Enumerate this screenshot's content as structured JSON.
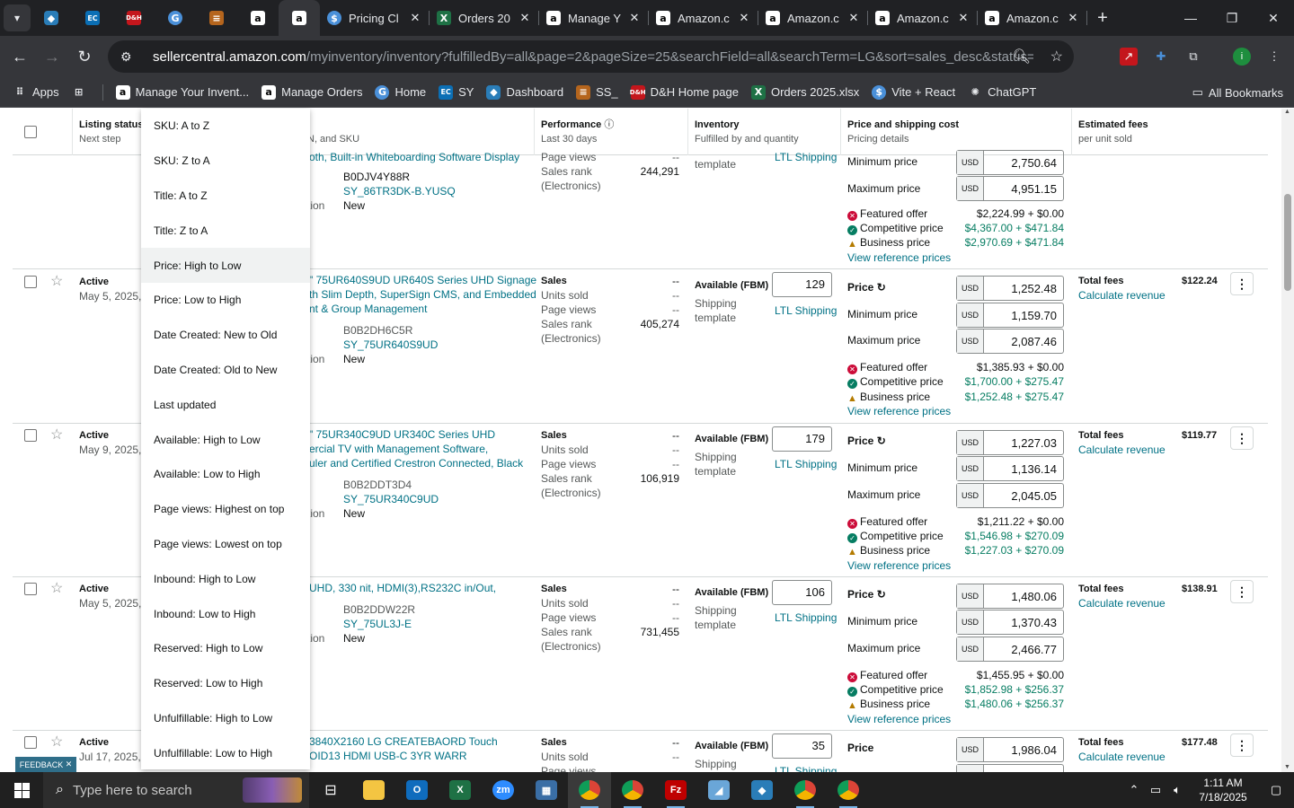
{
  "browser": {
    "tabs": [
      {
        "title": "Pricing Cl",
        "icon": "pricing-icon"
      },
      {
        "title": "Orders 20",
        "icon": "excel-icon"
      },
      {
        "title": "Manage Y",
        "icon": "amazon-icon"
      },
      {
        "title": "Amazon.c",
        "icon": "amazon-icon"
      },
      {
        "title": "Amazon.c",
        "icon": "amazon-icon"
      },
      {
        "title": "Amazon.c",
        "icon": "amazon-icon"
      },
      {
        "title": "Amazon.c",
        "icon": "amazon-icon"
      }
    ],
    "url_host": "sellercentral.amazon.com",
    "url_path": "/myinventory/inventory?fulfilledBy=all&page=2&pageSize=25&searchField=all&searchTerm=LG&sort=sales_desc&status=active&ref...",
    "profile_initial": "i",
    "bookmarks": [
      {
        "label": "Apps",
        "icon": "apps-grid-icon"
      },
      {
        "label": "Manage Your Invent...",
        "icon": "amazon-icon"
      },
      {
        "label": "Manage Orders",
        "icon": "amazon-icon"
      },
      {
        "label": "Home",
        "icon": "google-drive-icon"
      },
      {
        "label": "SY",
        "icon": "ec-icon"
      },
      {
        "label": "Dashboard",
        "icon": "dashboard-icon"
      },
      {
        "label": "SS_",
        "icon": "ss-icon"
      },
      {
        "label": "D&H Home page",
        "icon": "dh-icon"
      },
      {
        "label": "Orders 2025.xlsx",
        "icon": "excel-icon"
      },
      {
        "label": "Vite + React",
        "icon": "vite-icon"
      },
      {
        "label": "ChatGPT",
        "icon": "chatgpt-icon"
      }
    ],
    "all_bookmarks": "All Bookmarks"
  },
  "table_header": {
    "listing_status": "Listing status",
    "next_step": "Next step",
    "product_suffix": "N, and SKU",
    "performance": "Performance",
    "last_30_days": "Last 30 days",
    "inventory": "Inventory",
    "fulfilled_by": "Fulfilled by and quantity",
    "price_shipping": "Price and shipping cost",
    "pricing_details": "Pricing details",
    "estimated_fees": "Estimated fees",
    "per_unit": "per unit sold"
  },
  "labels": {
    "sales": "Sales",
    "units_sold": "Units sold",
    "page_views": "Page views",
    "sales_rank": "Sales rank",
    "electronics": "(Electronics)",
    "available_fbm": "Available (FBM)",
    "shipping": "Shipping",
    "template": "template",
    "ltl": "LTL Shipping",
    "price": "Price",
    "min_price": "Minimum price",
    "max_price": "Maximum price",
    "usd": "USD",
    "featured": "Featured offer",
    "competitive": "Competitive price",
    "business": "Business price",
    "view_ref": "View reference prices",
    "total_fees": "Total fees",
    "calc_revenue": "Calculate revenue",
    "condition_suffix": "tion",
    "condition": "New",
    "dash": "--",
    "active": "Active"
  },
  "partial_row": {
    "title": "oth, Built-in Whiteboarding Software Display",
    "asin": "B0DJV4Y88R",
    "sku": "SY_86TR3DK-B.YUSQ",
    "page_views_label": "Page views",
    "dash": "--",
    "sales_rank": "244,291",
    "min_price": "2,750.64",
    "max_price": "4,951.15",
    "featured": "$2,224.99 + $0.00",
    "competitive": "$4,367.00 + $471.84",
    "business": "$2,970.69 + $471.84",
    "ship_partial": "LTL Shipping"
  },
  "rows": [
    {
      "date": "May 5, 2025,",
      "title": [
        "\" 75UR640S9UD UR640S Series UHD Signage",
        "th Slim Depth, SuperSign CMS, and Embedded",
        "nt & Group Management"
      ],
      "asin": "B0B2DH6C5R",
      "sku": "SY_75UR640S9UD",
      "sales_rank": "405,274",
      "qty": "129",
      "price": "1,252.48",
      "min_price": "1,159.70",
      "max_price": "2,087.46",
      "featured": "$1,385.93 + $0.00",
      "competitive": "$1,700.00 + $275.47",
      "business": "$1,252.48 + $275.47",
      "fees": "$122.24"
    },
    {
      "date": "May 9, 2025,",
      "title": [
        "\" 75UR340C9UD UR340C Series UHD",
        "ercial TV with Management Software,",
        "uler and Certified Crestron Connected, Black"
      ],
      "asin": "B0B2DDT3D4",
      "sku": "SY_75UR340C9UD",
      "sales_rank": "106,919",
      "qty": "179",
      "price": "1,227.03",
      "min_price": "1,136.14",
      "max_price": "2,045.05",
      "featured": "$1,211.22 + $0.00",
      "competitive": "$1,546.98 + $270.09",
      "business": "$1,227.03 + $270.09",
      "fees": "$119.77"
    },
    {
      "date": "May 5, 2025,",
      "title": [
        "UHD, 330 nit, HDMI(3),RS232C in/Out,"
      ],
      "asin": "B0B2DDW22R",
      "sku": "SY_75UL3J-E",
      "sales_rank": "731,455",
      "qty": "106",
      "price": "1,480.06",
      "min_price": "1,370.43",
      "max_price": "2,466.77",
      "featured": "$1,455.95 + $0.00",
      "competitive": "$1,852.98 + $256.37",
      "business": "$1,480.06 + $256.37",
      "fees": "$138.91"
    },
    {
      "date": "Jul 17, 2025,",
      "title": [
        "3840X2160 LG CREATEBAORD Touch",
        "OID13 HDMI USB-C 3YR WARR"
      ],
      "qty": "35",
      "price": "1,986.04",
      "fees": "$177.48",
      "ltl_partial": "LTL Shipping"
    }
  ],
  "sort_menu": [
    "SKU: A to Z",
    "SKU: Z to A",
    "Title: A to Z",
    "Title: Z to A",
    "Price: High to Low",
    "Price: Low to High",
    "Date Created: New to Old",
    "Date Created: Old to New",
    "Last updated",
    "Available: High to Low",
    "Available: Low to High",
    "Page views: Highest on top",
    "Page views: Lowest on top",
    "Inbound: High to Low",
    "Inbound: Low to High",
    "Reserved: High to Low",
    "Reserved: Low to High",
    "Unfulfillable: High to Low",
    "Unfulfillable: Low to High"
  ],
  "sort_menu_highlighted": "Price: High to Low",
  "feedback": "FEEDBACK",
  "taskbar": {
    "search_placeholder": "Type here to search",
    "time": "1:11 AM",
    "date": "7/18/2025"
  },
  "colors": {
    "link": "#007185",
    "teal_price": "#067d62",
    "error_red": "#cc0c39",
    "chrome_dark": "#202124",
    "chrome_toolbar": "#35363a"
  }
}
